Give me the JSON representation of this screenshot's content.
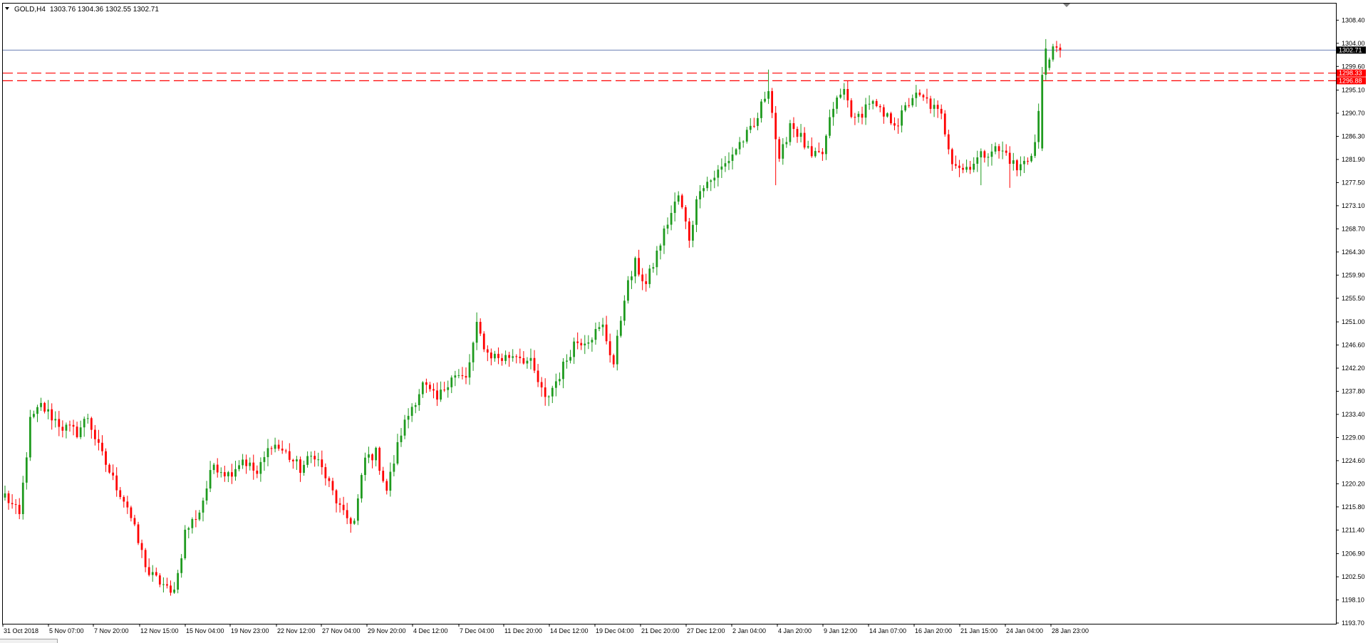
{
  "window": {
    "symbol_label": "GOLD,H4",
    "ohlc_text": "1303.76 1304.36 1302.55 1302.71"
  },
  "colors": {
    "bull": "#1e9a1e",
    "bear": "#ff0000",
    "bid_line": "#6b7fb4",
    "level_line": "#ff0000",
    "frame": "#000000"
  },
  "chart_data": {
    "type": "candlestick",
    "title": "",
    "symbol": "GOLD",
    "timeframe": "H4",
    "ylim": [
      1193.7,
      1309.8
    ],
    "y_ticks": [
      1308.4,
      1304.0,
      1299.6,
      1295.1,
      1290.7,
      1286.3,
      1281.9,
      1277.5,
      1273.1,
      1268.7,
      1264.3,
      1259.9,
      1255.5,
      1251.0,
      1246.6,
      1242.2,
      1237.8,
      1233.4,
      1229.0,
      1224.6,
      1220.2,
      1215.8,
      1211.4,
      1206.9,
      1202.5,
      1198.1,
      1193.7
    ],
    "x_ticks": [
      "31 Oct 2018",
      "5 Nov 07:00",
      "7 Nov 20:00",
      "12 Nov 15:00",
      "15 Nov 04:00",
      "19 Nov 23:00",
      "22 Nov 12:00",
      "27 Nov 04:00",
      "29 Nov 20:00",
      "4 Dec 12:00",
      "7 Dec 04:00",
      "11 Dec 20:00",
      "14 Dec 12:00",
      "19 Dec 04:00",
      "21 Dec 20:00",
      "27 Dec 12:00",
      "2 Jan 04:00",
      "4 Jan 20:00",
      "9 Jan 12:00",
      "14 Jan 07:00",
      "16 Jan 20:00",
      "21 Jan 15:00",
      "24 Jan 04:00",
      "28 Jan 23:00"
    ],
    "current_price": 1302.71,
    "levels": [
      1298.33,
      1296.88
    ],
    "anchors": [
      [
        0,
        1218
      ],
      [
        4,
        1214
      ],
      [
        7,
        1232
      ],
      [
        10,
        1235
      ],
      [
        16,
        1231
      ],
      [
        20,
        1230
      ],
      [
        23,
        1233
      ],
      [
        26,
        1227
      ],
      [
        30,
        1221
      ],
      [
        34,
        1216
      ],
      [
        37,
        1209
      ],
      [
        40,
        1203
      ],
      [
        44,
        1201
      ],
      [
        46,
        1199
      ],
      [
        48,
        1203
      ],
      [
        50,
        1211
      ],
      [
        54,
        1215
      ],
      [
        58,
        1224
      ],
      [
        62,
        1222
      ],
      [
        66,
        1225
      ],
      [
        70,
        1222
      ],
      [
        74,
        1228
      ],
      [
        78,
        1226
      ],
      [
        82,
        1223
      ],
      [
        86,
        1226
      ],
      [
        90,
        1220
      ],
      [
        94,
        1214
      ],
      [
        97,
        1213
      ],
      [
        100,
        1225
      ],
      [
        103,
        1226
      ],
      [
        106,
        1219
      ],
      [
        110,
        1230
      ],
      [
        113,
        1235
      ],
      [
        116,
        1239
      ],
      [
        120,
        1236
      ],
      [
        124,
        1241
      ],
      [
        128,
        1240
      ],
      [
        131,
        1250
      ],
      [
        134,
        1245
      ],
      [
        138,
        1244
      ],
      [
        142,
        1245
      ],
      [
        146,
        1243
      ],
      [
        150,
        1236
      ],
      [
        154,
        1241
      ],
      [
        158,
        1247
      ],
      [
        162,
        1248
      ],
      [
        166,
        1250
      ],
      [
        169,
        1243
      ],
      [
        172,
        1256
      ],
      [
        175,
        1262
      ],
      [
        178,
        1258
      ],
      [
        181,
        1264
      ],
      [
        184,
        1270
      ],
      [
        187,
        1275
      ],
      [
        190,
        1267
      ],
      [
        193,
        1277
      ],
      [
        196,
        1278
      ],
      [
        200,
        1281
      ],
      [
        204,
        1285
      ],
      [
        208,
        1288
      ],
      [
        212,
        1296
      ],
      [
        215,
        1281
      ],
      [
        218,
        1289
      ],
      [
        221,
        1286
      ],
      [
        224,
        1282
      ],
      [
        227,
        1283
      ],
      [
        230,
        1292
      ],
      [
        233,
        1295
      ],
      [
        236,
        1289
      ],
      [
        240,
        1293
      ],
      [
        244,
        1290
      ],
      [
        248,
        1289
      ],
      [
        252,
        1294
      ],
      [
        256,
        1293
      ],
      [
        260,
        1290
      ],
      [
        263,
        1282
      ],
      [
        266,
        1280
      ],
      [
        270,
        1282
      ],
      [
        274,
        1284
      ],
      [
        278,
        1283
      ],
      [
        281,
        1280
      ],
      [
        284,
        1282
      ],
      [
        286,
        1285
      ],
      [
        288,
        1297
      ],
      [
        290,
        1302
      ],
      [
        293,
        1302.7
      ]
    ]
  }
}
